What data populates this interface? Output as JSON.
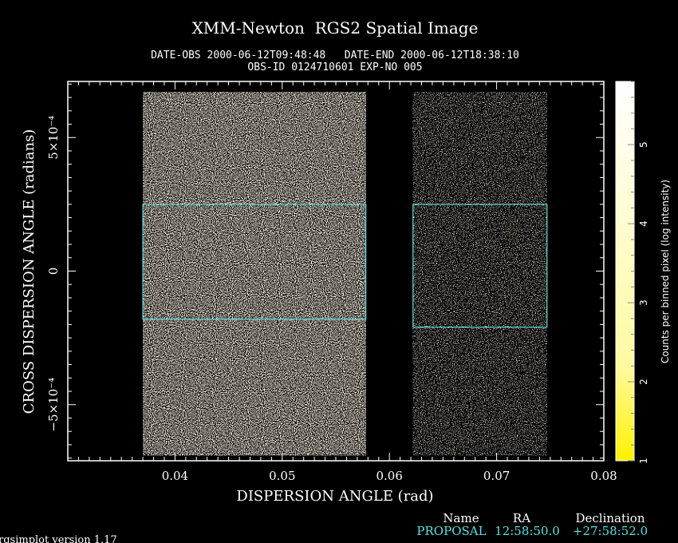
{
  "header": {
    "title": "XMM-Newton  RGS2 Spatial Image",
    "line1": "DATE-OBS 2000-06-12T09:48:48   DATE-END 2000-06-12T18:38:10",
    "line2": "OBS-ID 0124710601 EXP-NO 005"
  },
  "footer": {
    "table_header": [
      "Name",
      "RA",
      "Declination"
    ],
    "row": [
      "PROPOSAL",
      "12:58:50.0",
      "+27:58:52.0"
    ],
    "version": "rgsimplot version 1.17"
  },
  "colors": {
    "background": "#000000",
    "text": "#ffffff",
    "region": "#5fe0e0",
    "colormap_low": "#fff200",
    "colormap_high": "#ffffff",
    "footer_row": "#5fe0e0"
  },
  "chart_data": {
    "type": "heatmap",
    "title": "XMM-Newton  RGS2 Spatial Image",
    "xlabel": "DISPERSION ANGLE (rad)",
    "ylabel": "CROSS DISPERSION ANGLE (radians)",
    "xlim": [
      0.03,
      0.08
    ],
    "ylim": [
      -0.00071,
      0.00071
    ],
    "x_ticks": [
      {
        "value": 0.04,
        "label": "0.04"
      },
      {
        "value": 0.05,
        "label": "0.05"
      },
      {
        "value": 0.06,
        "label": "0.06"
      },
      {
        "value": 0.07,
        "label": "0.07"
      },
      {
        "value": 0.08,
        "label": "0.08"
      }
    ],
    "y_ticks": [
      {
        "value": 0.0005,
        "label": "5×10⁻⁴"
      },
      {
        "value": 0,
        "label": "0"
      },
      {
        "value": -0.0005,
        "label": "−5×10⁻⁴"
      }
    ],
    "data_strips": [
      {
        "x_range": [
          0.037,
          0.0578
        ],
        "y_range": [
          -0.00069,
          0.00067
        ],
        "brightness": "high"
      },
      {
        "x_range": [
          0.0622,
          0.0747
        ],
        "y_range": [
          -0.00069,
          0.00067
        ],
        "brightness": "low"
      }
    ],
    "regions": [
      {
        "x_range": [
          0.037,
          0.0578
        ],
        "y_range": [
          -0.00018,
          0.00025
        ]
      },
      {
        "x_range": [
          0.0622,
          0.0747
        ],
        "y_range": [
          -0.00021,
          0.00025
        ]
      }
    ],
    "colorbar": {
      "label": "Counts per binned pixel (log intensity)",
      "range": [
        1,
        5.8
      ],
      "ticks": [
        {
          "value": 1,
          "label": "1"
        },
        {
          "value": 2,
          "label": "2"
        },
        {
          "value": 3,
          "label": "3"
        },
        {
          "value": 4,
          "label": "4"
        },
        {
          "value": 5,
          "label": "5"
        }
      ],
      "colormap": "yellow-to-white (log)"
    }
  }
}
